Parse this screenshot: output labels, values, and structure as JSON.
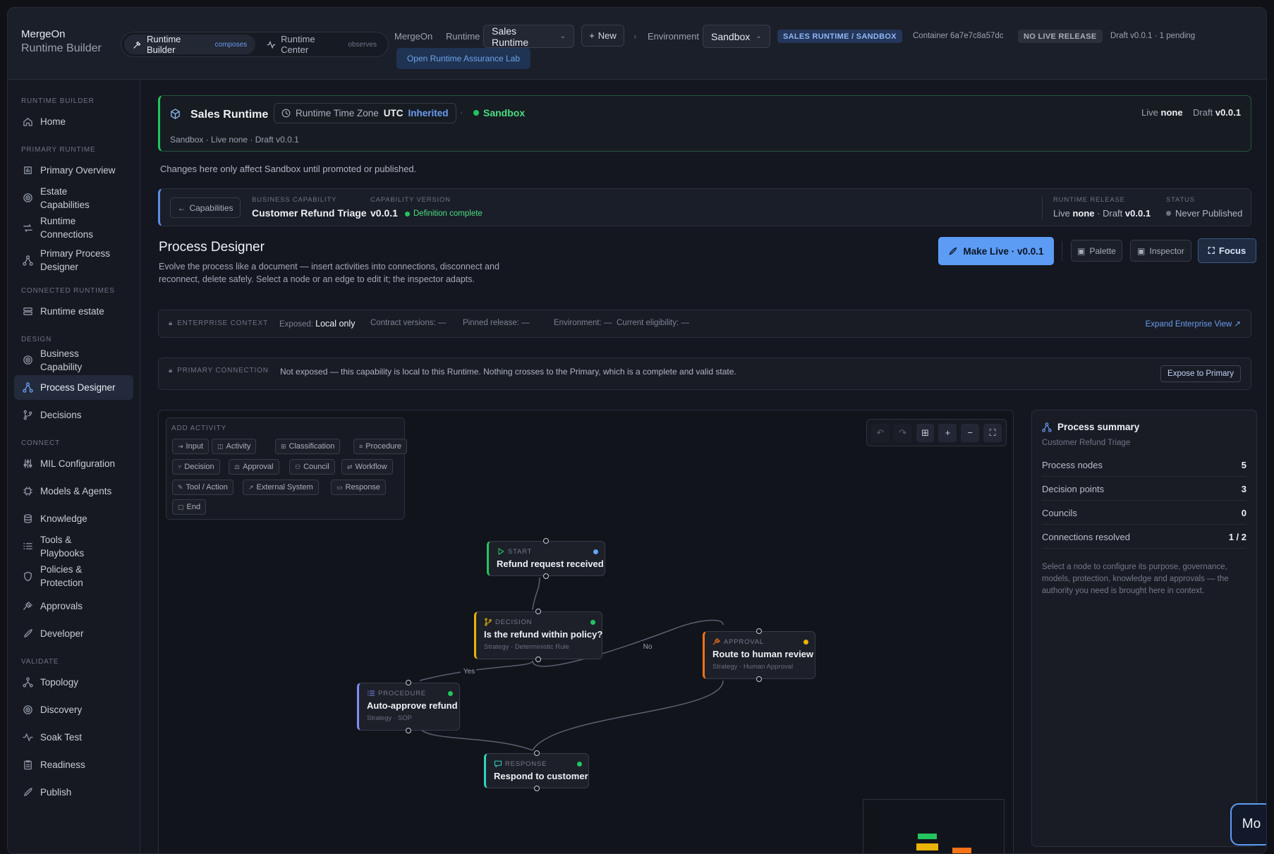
{
  "brand": {
    "line1": "MergeOn",
    "line2": "Runtime Builder"
  },
  "modes": [
    {
      "label": "Runtime Builder",
      "sub": "composes",
      "icon": "builder-icon"
    },
    {
      "label": "Runtime Center",
      "sub": "observes",
      "icon": "pulse-icon"
    }
  ],
  "topbar": {
    "crumb": "MergeOn",
    "runtime_label": "Runtime",
    "runtime_value": "Sales Runtime",
    "new_label": "New",
    "env_label": "Environment",
    "env_value": "Sandbox",
    "context_pill": "SALES RUNTIME / SANDBOX",
    "container": "Container 6a7e7c8a57dc",
    "release_pill": "NO LIVE RELEASE",
    "draft_info": "Draft v0.0.1 · 1 pending",
    "assurance_label": "Open Runtime Assurance Lab"
  },
  "sidebar": [
    {
      "section": "RUNTIME BUILDER",
      "items": [
        {
          "label": "Home",
          "icon": "home-icon"
        }
      ]
    },
    {
      "section": "PRIMARY RUNTIME",
      "items": [
        {
          "label": "Primary Overview",
          "icon": "chart-icon"
        },
        {
          "label": "Estate Capabilities",
          "icon": "target-icon"
        },
        {
          "label": "Runtime Connections",
          "icon": "arrows-icon"
        },
        {
          "label": "Primary Process Designer",
          "icon": "flow-icon"
        }
      ]
    },
    {
      "section": "CONNECTED RUNTIMES",
      "items": [
        {
          "label": "Runtime estate",
          "icon": "server-icon"
        }
      ]
    },
    {
      "section": "DESIGN",
      "items": [
        {
          "label": "Business Capability",
          "icon": "target-icon"
        },
        {
          "label": "Process Designer",
          "icon": "flow-icon",
          "active": true
        },
        {
          "label": "Decisions",
          "icon": "branch-icon"
        }
      ]
    },
    {
      "section": "CONNECT",
      "items": [
        {
          "label": "MIL Configuration",
          "icon": "sliders-icon"
        },
        {
          "label": "Models & Agents",
          "icon": "cpu-icon"
        },
        {
          "label": "Knowledge",
          "icon": "database-icon"
        },
        {
          "label": "Tools & Playbooks",
          "icon": "list-icon"
        },
        {
          "label": "Policies & Protection",
          "icon": "shield-icon"
        },
        {
          "label": "Approvals",
          "icon": "gavel-icon"
        },
        {
          "label": "Developer",
          "icon": "rocket-icon"
        }
      ]
    },
    {
      "section": "VALIDATE",
      "items": [
        {
          "label": "Topology",
          "icon": "topology-icon"
        },
        {
          "label": "Discovery",
          "icon": "target-icon"
        },
        {
          "label": "Soak Test",
          "icon": "pulse-icon"
        },
        {
          "label": "Readiness",
          "icon": "clipboard-icon"
        },
        {
          "label": "Publish",
          "icon": "rocket-icon"
        }
      ]
    }
  ],
  "runtime_card": {
    "title": "Sales Runtime",
    "tz_label": "Runtime Time Zone",
    "tz_value": "UTC",
    "tz_inherited": "Inherited",
    "sep": "·",
    "env": "Sandbox",
    "live_label": "Live",
    "live_value": "none",
    "draft_label": "Draft",
    "draft_value": "v0.0.1",
    "subline": "Sandbox · Live none · Draft v0.0.1",
    "note": "Changes here only affect Sandbox until promoted or published."
  },
  "capability_card": {
    "back_label": "Capabilities",
    "bc_label": "BUSINESS CAPABILITY",
    "bc_value": "Customer Refund Triage",
    "ver_label": "CAPABILITY VERSION",
    "ver_value": "v0.0.1",
    "ver_status": "Definition complete",
    "rel_label": "RUNTIME RELEASE",
    "rel_live": "Live",
    "rel_live_value": "none",
    "rel_draft": "· Draft",
    "rel_draft_value": "v0.0.1",
    "status_label": "STATUS",
    "status_value": "Never Published"
  },
  "designer": {
    "title": "Process Designer",
    "description": "Evolve the process like a document — insert activities into connections, disconnect and reconnect, delete safely. Select a node or an edge to edit it; the inspector adapts.",
    "make_live": "Make Live · v0.0.1",
    "palette_btn": "Palette",
    "inspector_btn": "Inspector",
    "focus_btn": "Focus"
  },
  "enterprise": {
    "label": "ENTERPRISE CONTEXT",
    "exposed_label": "Exposed:",
    "exposed_value": "Local only",
    "contract_label": "Contract versions:",
    "contract_value": "—",
    "pinned_label": "Pinned release:",
    "pinned_value": "—",
    "env_label": "Environment:",
    "env_value": "—",
    "elig_label": "Current eligibility:",
    "elig_value": "—",
    "expand": "Expand Enterprise View ↗"
  },
  "primary_connection": {
    "label": "PRIMARY CONNECTION",
    "text": "Not exposed — this capability is local to this Runtime. Nothing crosses to the Primary, which is a complete and valid state.",
    "button": "Expose to Primary"
  },
  "palette": {
    "header": "ADD ACTIVITY",
    "chips": [
      "Input",
      "Activity",
      "Classification",
      "Procedure",
      "Decision",
      "Approval",
      "Council",
      "Workflow",
      "Tool / Action",
      "External System",
      "Response",
      "End"
    ]
  },
  "nodes": [
    {
      "kind": "START",
      "title": "Refund request received",
      "sub": "",
      "accent": "#22c55e",
      "status": "#60a5fa",
      "icon": "play-icon"
    },
    {
      "kind": "DECISION",
      "title": "Is the refund within policy?",
      "sub": "Strategy · Deterministic Rule",
      "accent": "#eab308",
      "status": "#22c55e",
      "icon": "branch-icon"
    },
    {
      "kind": "APPROVAL",
      "title": "Route to human review",
      "sub": "Strategy · Human Approval",
      "accent": "#f97316",
      "status": "#eab308",
      "icon": "gavel-icon"
    },
    {
      "kind": "PROCEDURE",
      "title": "Auto-approve refund",
      "sub": "Strategy · SOP",
      "accent": "#818cf8",
      "status": "#22c55e",
      "icon": "list-icon"
    },
    {
      "kind": "RESPONSE",
      "title": "Respond to customer",
      "sub": "",
      "accent": "#2dd4bf",
      "status": "#22c55e",
      "icon": "message-icon"
    }
  ],
  "edges": {
    "yes": "Yes",
    "no": "No"
  },
  "summary": {
    "title": "Process summary",
    "subtitle": "Customer Refund Triage",
    "rows": [
      {
        "label": "Process nodes",
        "value": "5"
      },
      {
        "label": "Decision points",
        "value": "3"
      },
      {
        "label": "Councils",
        "value": "0"
      },
      {
        "label": "Connections resolved",
        "value": "1 / 2"
      }
    ],
    "help": "Select a node to configure its purpose, governance, models, protection, knowledge and approvals — the authority you need is brought here in context."
  },
  "assistant": {
    "label": "Mo"
  }
}
